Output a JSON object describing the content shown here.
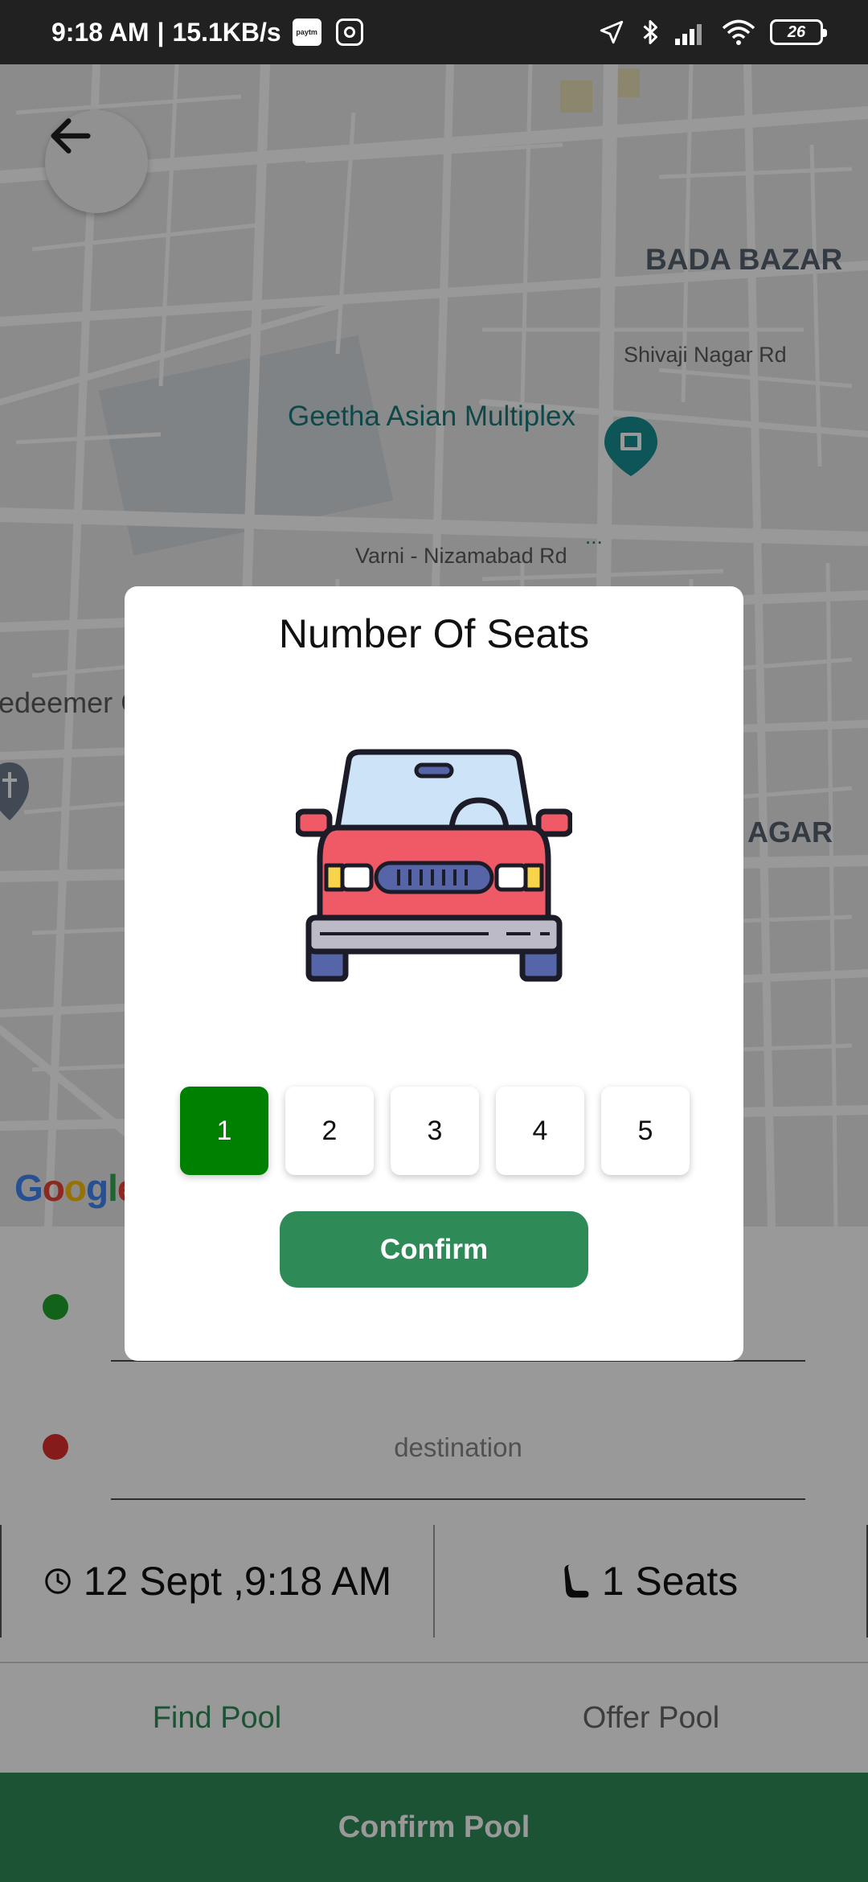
{
  "status_bar": {
    "time": "9:18 AM",
    "separator": "|",
    "speed": "15.1KB/s",
    "paytm_label": "paytm",
    "battery": "26"
  },
  "map": {
    "labels": {
      "bada_bazar": "BADA BAZAR",
      "shivaji_nagar": "Shivaji Nagar Rd",
      "geetha": "Geetha Asian Multiplex",
      "varni": "Varni - Nizamabad Rd",
      "redeemer": "edeemer C",
      "nagar": "AGAR",
      "ellipsis": "..."
    },
    "google": [
      "G",
      "o",
      "o",
      "g",
      "l",
      "e"
    ],
    "google_colors": [
      "#4285F4",
      "#EA4335",
      "#FBBC05",
      "#4285F4",
      "#34A853",
      "#EA4335"
    ]
  },
  "form": {
    "destination_placeholder": "destination",
    "date_time": "12 Sept ,9:18 AM",
    "seats_display": "1 Seats"
  },
  "tabs": {
    "find_pool": "Find Pool",
    "offer_pool": "Offer Pool"
  },
  "confirm_pool_label": "Confirm Pool",
  "modal": {
    "title": "Number Of Seats",
    "seat_options": [
      "1",
      "2",
      "3",
      "4",
      "5"
    ],
    "selected_seat": "1",
    "confirm_label": "Confirm"
  },
  "colors": {
    "primary_green": "#2e8b57",
    "selected_green": "#008000",
    "car_body": "#f05a67",
    "car_window": "#cde3f7",
    "car_wheels": "#5565a7"
  }
}
